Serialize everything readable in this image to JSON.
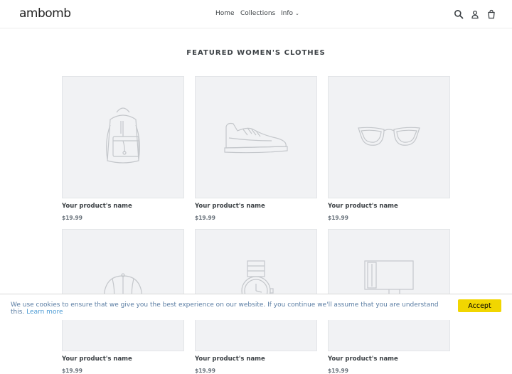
{
  "brand": {
    "logo_text": "ambomb"
  },
  "nav": {
    "items": [
      {
        "label": "Home"
      },
      {
        "label": "Collections"
      },
      {
        "label": "Info"
      }
    ]
  },
  "header_icons": [
    "search-icon",
    "account-icon",
    "cart-icon"
  ],
  "section": {
    "title": "FEATURED WOMEN'S CLOTHES"
  },
  "products": [
    {
      "name": "Your product's name",
      "price": "$19.99",
      "icon": "backpack-icon"
    },
    {
      "name": "Your product's name",
      "price": "$19.99",
      "icon": "sneaker-icon"
    },
    {
      "name": "Your product's name",
      "price": "$19.99",
      "icon": "glasses-icon"
    },
    {
      "name": "Your product's name",
      "price": "$19.99",
      "icon": "cap-icon"
    },
    {
      "name": "Your product's name",
      "price": "$19.99",
      "icon": "watch-icon"
    },
    {
      "name": "Your product's name",
      "price": "$19.99",
      "icon": "lamp-icon"
    }
  ],
  "cookie": {
    "message": "We use cookies to ensure that we give you the best experience on our website. If you continue we'll assume that you are understand this.",
    "link_label": "Learn more",
    "accept_label": "Accept"
  },
  "colors": {
    "accent_button": "#f1d600",
    "link": "#4a9ad4",
    "placeholder_bg": "#f1f2f4"
  }
}
